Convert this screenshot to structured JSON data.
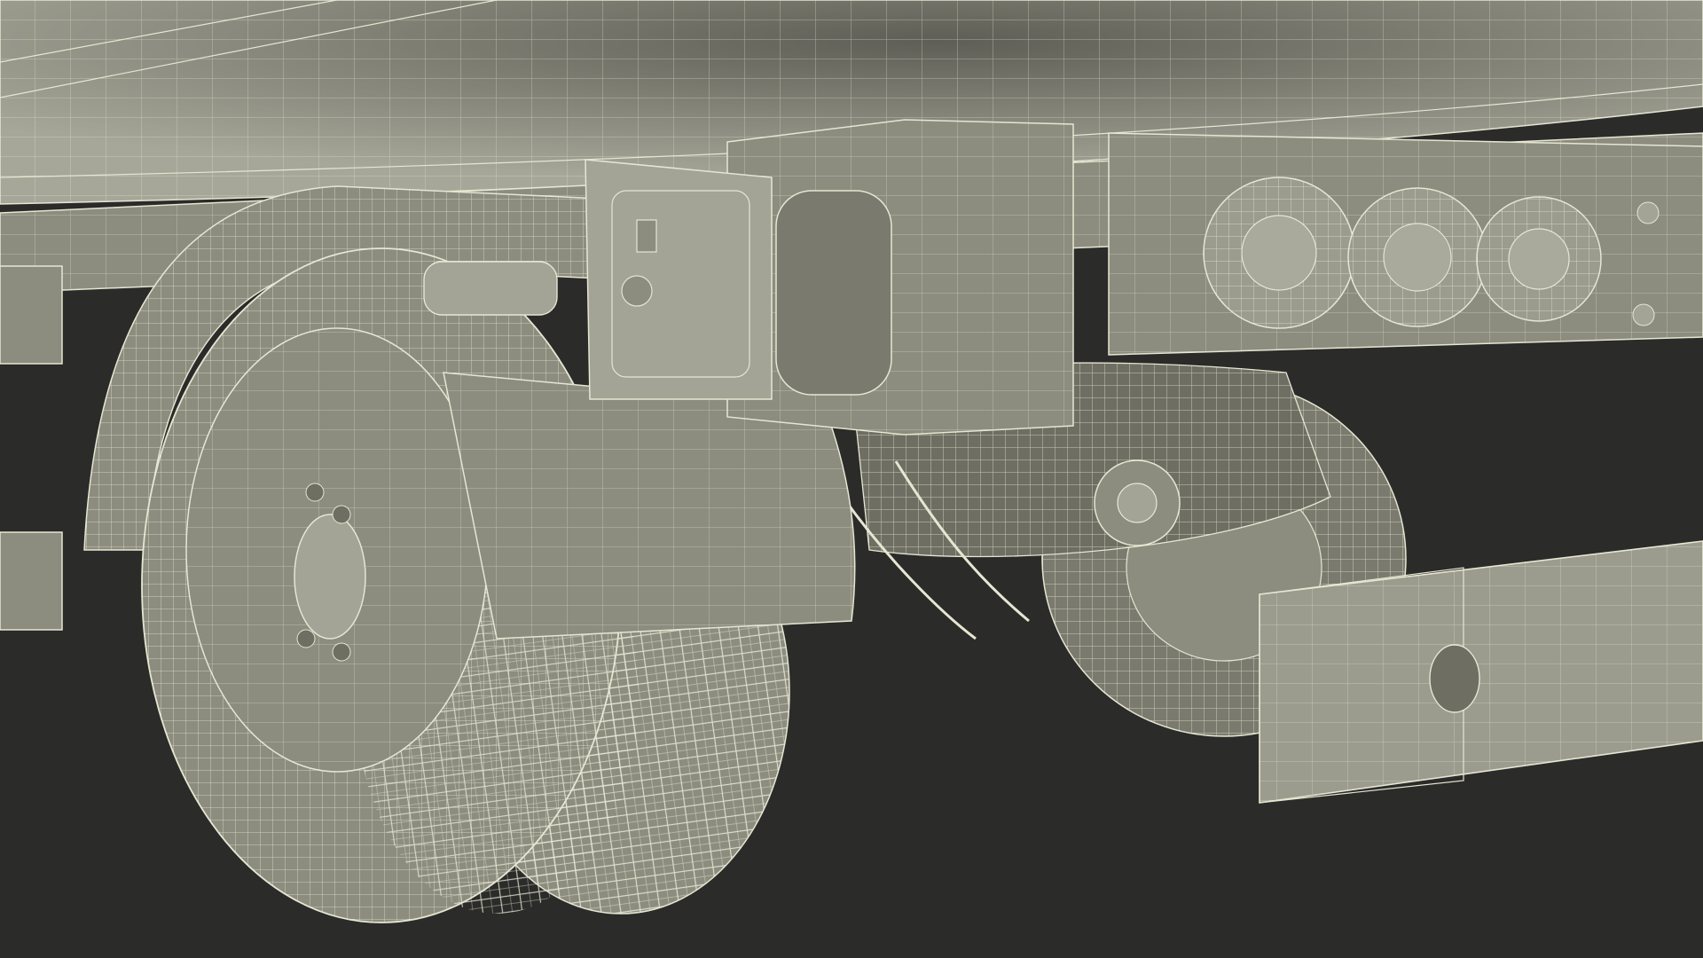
{
  "scene": {
    "subject": "truck-rear-undercarriage-wireframe",
    "colors": {
      "background": "#2b2b2a",
      "panel": "#8c8c7f",
      "panel_light": "#a3a396",
      "panel_dark": "#6e6e63",
      "wire": "#e6e6d2",
      "shadow": "#3a3a36"
    },
    "objects": [
      "trailer-body",
      "frame-rail",
      "fender",
      "mudguard",
      "outer-wheel",
      "inner-wheel",
      "utility-box",
      "rear-light-cluster",
      "rear-bumper",
      "suspension",
      "distant-wheel"
    ]
  }
}
